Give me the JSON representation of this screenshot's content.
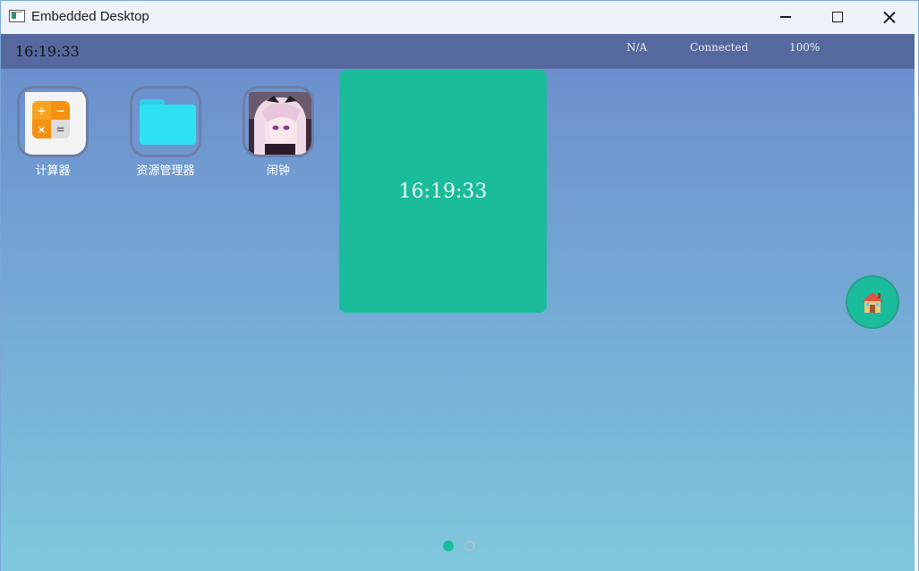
{
  "window": {
    "title": "Embedded Desktop"
  },
  "statusbar": {
    "time": "16:19:33",
    "signal": "N/A",
    "network": "Connected",
    "battery": "100%"
  },
  "apps": [
    {
      "label": "计算器",
      "icon": "calculator-icon",
      "calc_keys": [
        "+",
        "−",
        "×",
        "="
      ]
    },
    {
      "label": "资源管理器",
      "icon": "folder-icon"
    },
    {
      "label": "闹钟",
      "icon": "anime-avatar-icon"
    }
  ],
  "clock_widget": {
    "time": "16:19:33"
  },
  "home_button": {
    "icon": "house-icon"
  },
  "pagination": {
    "pages": 2,
    "current": 1
  },
  "colors": {
    "accent": "#1abc9c",
    "statusbar": "#56699e",
    "gradient_top": "#6a8ccd",
    "gradient_bottom": "#7ec8dd"
  }
}
